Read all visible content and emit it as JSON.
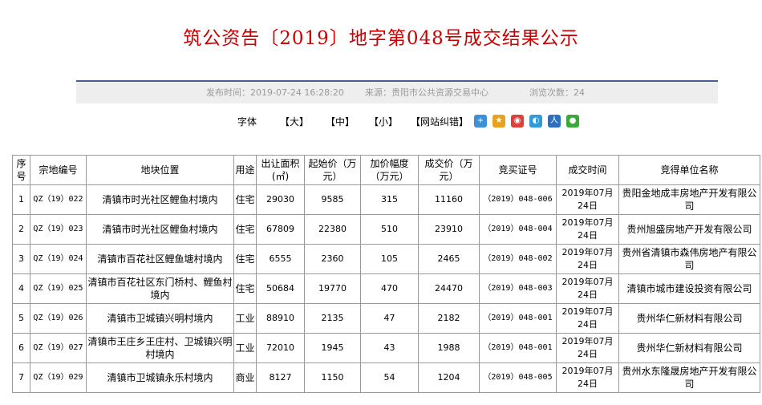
{
  "page_title": "筑公资告〔2019〕地字第048号成交结果公示",
  "meta": {
    "publish_time": "发布时间：2019-07-24 16:28:20",
    "source": "来源：贵阳市公共资源交易中心",
    "views": "浏览次数：24"
  },
  "font_controls": {
    "label": "字体",
    "large": "【大】",
    "medium": "【中】",
    "small": "【小】",
    "report_error": "【网站纠错】"
  },
  "share_icons": [
    "add-icon",
    "star-icon",
    "weibo-icon",
    "zone-icon",
    "renren-icon",
    "wechat-icon"
  ],
  "table": {
    "headers": {
      "index": "序号",
      "parcel_id": "宗地编号",
      "location": "地块位置",
      "use": "用途",
      "area": "出让面积(㎡)",
      "start_price": "起始价（万元）",
      "increase": "加价幅度（万元）",
      "final_price": "成交价（万元）",
      "cert_no": "竞买证号",
      "deal_time": "成交时间",
      "winner": "竞得单位名称"
    },
    "rows": [
      {
        "index": "1",
        "parcel_id": "QZ（19）022",
        "location": "清镇市时光社区鲤鱼村境内",
        "use": "住宅",
        "area": "29030",
        "start_price": "9585",
        "increase": "315",
        "final_price": "11160",
        "cert_no": "（2019）048-006",
        "deal_time": "2019年07月24日",
        "winner": "贵阳金地成丰房地产开发有限公司"
      },
      {
        "index": "2",
        "parcel_id": "QZ（19）023",
        "location": "清镇市时光社区鲤鱼村境内",
        "use": "住宅",
        "area": "67809",
        "start_price": "22380",
        "increase": "510",
        "final_price": "23910",
        "cert_no": "（2019）048-004",
        "deal_time": "2019年07月24日",
        "winner": "贵州旭盛房地产开发有限公司"
      },
      {
        "index": "3",
        "parcel_id": "QZ（19）024",
        "location": "清镇市百花社区鲤鱼塘村境内",
        "use": "住宅",
        "area": "6555",
        "start_price": "2360",
        "increase": "105",
        "final_price": "2465",
        "cert_no": "（2019）048-002",
        "deal_time": "2019年07月24日",
        "winner": "贵州省清镇市森伟房地产有限公司"
      },
      {
        "index": "4",
        "parcel_id": "QZ（19）025",
        "location": "清镇市百花社区东门桥村、鲤鱼村境内",
        "use": "住宅",
        "area": "50684",
        "start_price": "19770",
        "increase": "470",
        "final_price": "24470",
        "cert_no": "（2019）048-003",
        "deal_time": "2019年07月24日",
        "winner": "清镇市城市建设投资有限公司"
      },
      {
        "index": "5",
        "parcel_id": "QZ（19）026",
        "location": "清镇市卫城镇兴明村境内",
        "use": "工业",
        "area": "88910",
        "start_price": "2135",
        "increase": "47",
        "final_price": "2182",
        "cert_no": "（2019）048-001",
        "deal_time": "2019年07月24日",
        "winner": "贵州华仁新材料有限公司"
      },
      {
        "index": "6",
        "parcel_id": "QZ（19）027",
        "location": "清镇市王庄乡王庄村、卫城镇兴明村境内",
        "use": "工业",
        "area": "72010",
        "start_price": "1945",
        "increase": "43",
        "final_price": "1988",
        "cert_no": "（2019）048-001",
        "deal_time": "2019年07月24日",
        "winner": "贵州华仁新材料有限公司"
      },
      {
        "index": "7",
        "parcel_id": "QZ（19）029",
        "location": "清镇市卫城镇永乐村境内",
        "use": "商业",
        "area": "8127",
        "start_price": "1150",
        "increase": "54",
        "final_price": "1204",
        "cert_no": "（2019）048-005",
        "deal_time": "2019年07月24日",
        "winner": "贵州水东隆晟房地产开发有限公司"
      }
    ]
  }
}
